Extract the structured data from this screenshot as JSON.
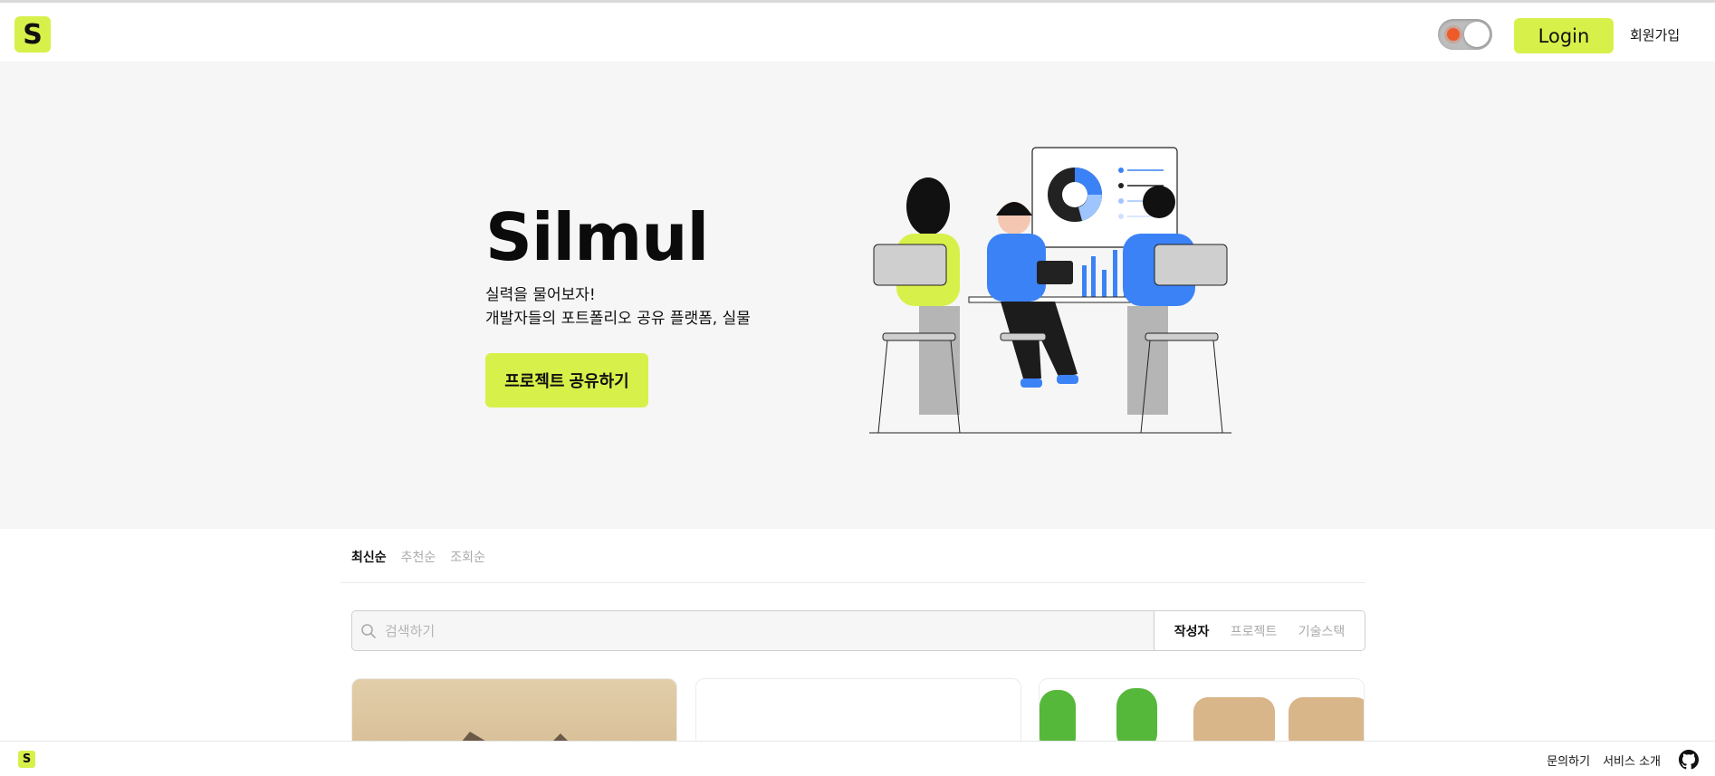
{
  "header": {
    "logo_letter": "S",
    "login_label": "Login",
    "signup_label": "회원가입"
  },
  "hero": {
    "title": "Silmul",
    "line1": "실력을 물어보자!",
    "line2": "개발자들의 포트폴리오 공유 플랫폼, 실물",
    "cta_label": "프로젝트 공유하기"
  },
  "sort": {
    "tabs": [
      "최신순",
      "추천순",
      "조회순"
    ],
    "active_index": 0
  },
  "search": {
    "placeholder": "검색하기",
    "value": "",
    "filters": [
      "작성자",
      "프로젝트",
      "기술스택"
    ],
    "active_filter_index": 0
  },
  "footer": {
    "logo_letter": "S",
    "links": [
      "문의하기",
      "서비스 소개"
    ]
  },
  "colors": {
    "accent": "#d8f04a",
    "hero_bg": "#f6f6f6",
    "blue": "#3b82f6"
  },
  "icons": [
    "theme-toggle-sun-icon",
    "search-icon",
    "github-icon"
  ]
}
